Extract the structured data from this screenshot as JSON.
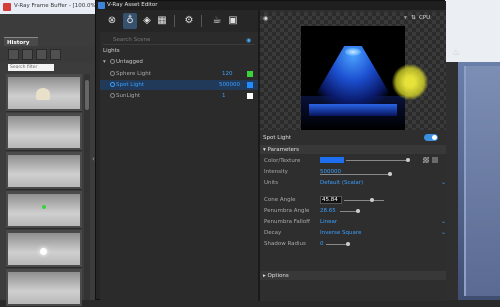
{
  "framebuffer": {
    "title": "V-Ray Frame Buffer - [100.0% of ...",
    "history_tab": "History",
    "search_placeholder": "Search filter"
  },
  "editor": {
    "title": "V-Ray Asset Editor",
    "toolbar_icons": [
      "material-sphere-icon",
      "light-bulb-icon",
      "geometry-icon",
      "texture-icon",
      "settings-gear-icon",
      "render-teapot-icon",
      "frame-buffer-icon"
    ],
    "search_placeholder": "Search Scene",
    "lights_header": "Lights",
    "group_label": "Untagged",
    "lights": [
      {
        "name": "Sphere Light",
        "value": "120",
        "color": "#3ad43a"
      },
      {
        "name": "Spot Light",
        "value": "500000",
        "color": "#1f8cff"
      },
      {
        "name": "SunLight",
        "value": "1",
        "color": "#ffffff"
      }
    ],
    "preview": {
      "cpu_label": "CPU"
    },
    "properties": {
      "title": "Spot Light",
      "enabled": true,
      "section_params": "Parameters",
      "section_options": "Options",
      "rows": [
        {
          "label": "Color/Texture",
          "value": ""
        },
        {
          "label": "Intensity",
          "value": "500000"
        },
        {
          "label": "Units",
          "value": "Default (Scalar)"
        },
        {
          "label": "Cone Angle",
          "value": "45.84"
        },
        {
          "label": "Penumbra Angle",
          "value": "28.65"
        },
        {
          "label": "Penumbra Falloff",
          "value": "Linear"
        },
        {
          "label": "Decay",
          "value": "Inverse Square"
        },
        {
          "label": "Shadow Radius",
          "value": "0"
        }
      ]
    }
  }
}
